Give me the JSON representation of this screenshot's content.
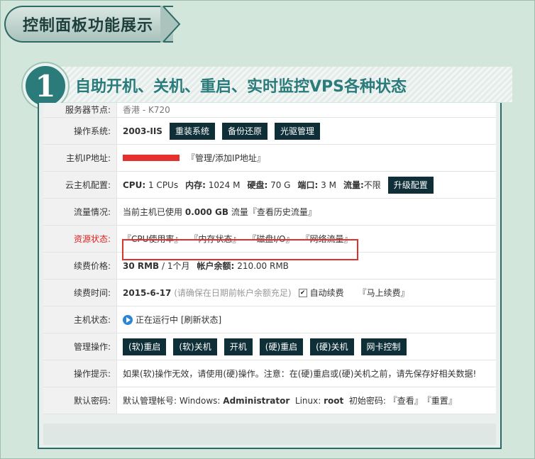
{
  "banner": {
    "title": "控制面板功能展示"
  },
  "section": {
    "number": "1",
    "title": "自助开机、关机、重启、实时监控VPS各种状态"
  },
  "rows": {
    "node": {
      "label": "服务器节点:",
      "value": "香港 - K720"
    },
    "os": {
      "label": "操作系统:",
      "value": "2003-IIS",
      "buttons": [
        "重装系统",
        "备份还原",
        "光驱管理"
      ]
    },
    "ip": {
      "label": "主机IP地址:",
      "link": "『管理/添加IP地址』"
    },
    "config": {
      "label": "云主机配置:",
      "cpu_label": "CPU:",
      "cpu_value": "1 CPUs",
      "mem_label": "内存:",
      "mem_value": "1024 M",
      "disk_label": "硬盘:",
      "disk_value": "70 G",
      "port_label": "端口:",
      "port_value": "3 M",
      "traffic_label": "流量:",
      "traffic_value": "不限",
      "button": "升级配置"
    },
    "traffic": {
      "label": "流量情况:",
      "prefix": "当前主机已使用",
      "amount": "0.000 GB",
      "suffix": "流量『查看历史流量』"
    },
    "resource": {
      "label": "资源状态:",
      "links": [
        "『CPU使用率』",
        "『内存状态』",
        "『磁盘I/O』",
        "『网络流量』"
      ]
    },
    "price": {
      "label": "续费价格:",
      "price": "30 RMB",
      "period": "/ 1个月",
      "balance_label": "帐户余额:",
      "balance": "210.00 RMB"
    },
    "renew": {
      "label": "续费时间:",
      "date": "2015-6-17",
      "note": "(请确保在日期前帐户余额充足)",
      "auto": "自动续费",
      "link": "『马上续费』"
    },
    "status": {
      "label": "主机状态:",
      "value": "正在运行中",
      "refresh": "[刷新状态]"
    },
    "manage": {
      "label": "管理操作:",
      "buttons": [
        "(软)重启",
        "(软)关机",
        "开机",
        "(硬)重启",
        "(硬)关机",
        "网卡控制"
      ]
    },
    "tip": {
      "label": "操作提示:",
      "value": "如果(软)操作无效，请使用(硬)操作。注意：在(硬)重启或(硬)关机之前，请先保存好相关数据!"
    },
    "password": {
      "label": "默认密码:",
      "prefix": "默认管理帐号: Windows:",
      "win_user": "Administrator",
      "linux_label": "Linux:",
      "linux_user": "root",
      "pwd_label": "初始密码:",
      "view": "『查看』",
      "reset": "『重置』"
    }
  }
}
